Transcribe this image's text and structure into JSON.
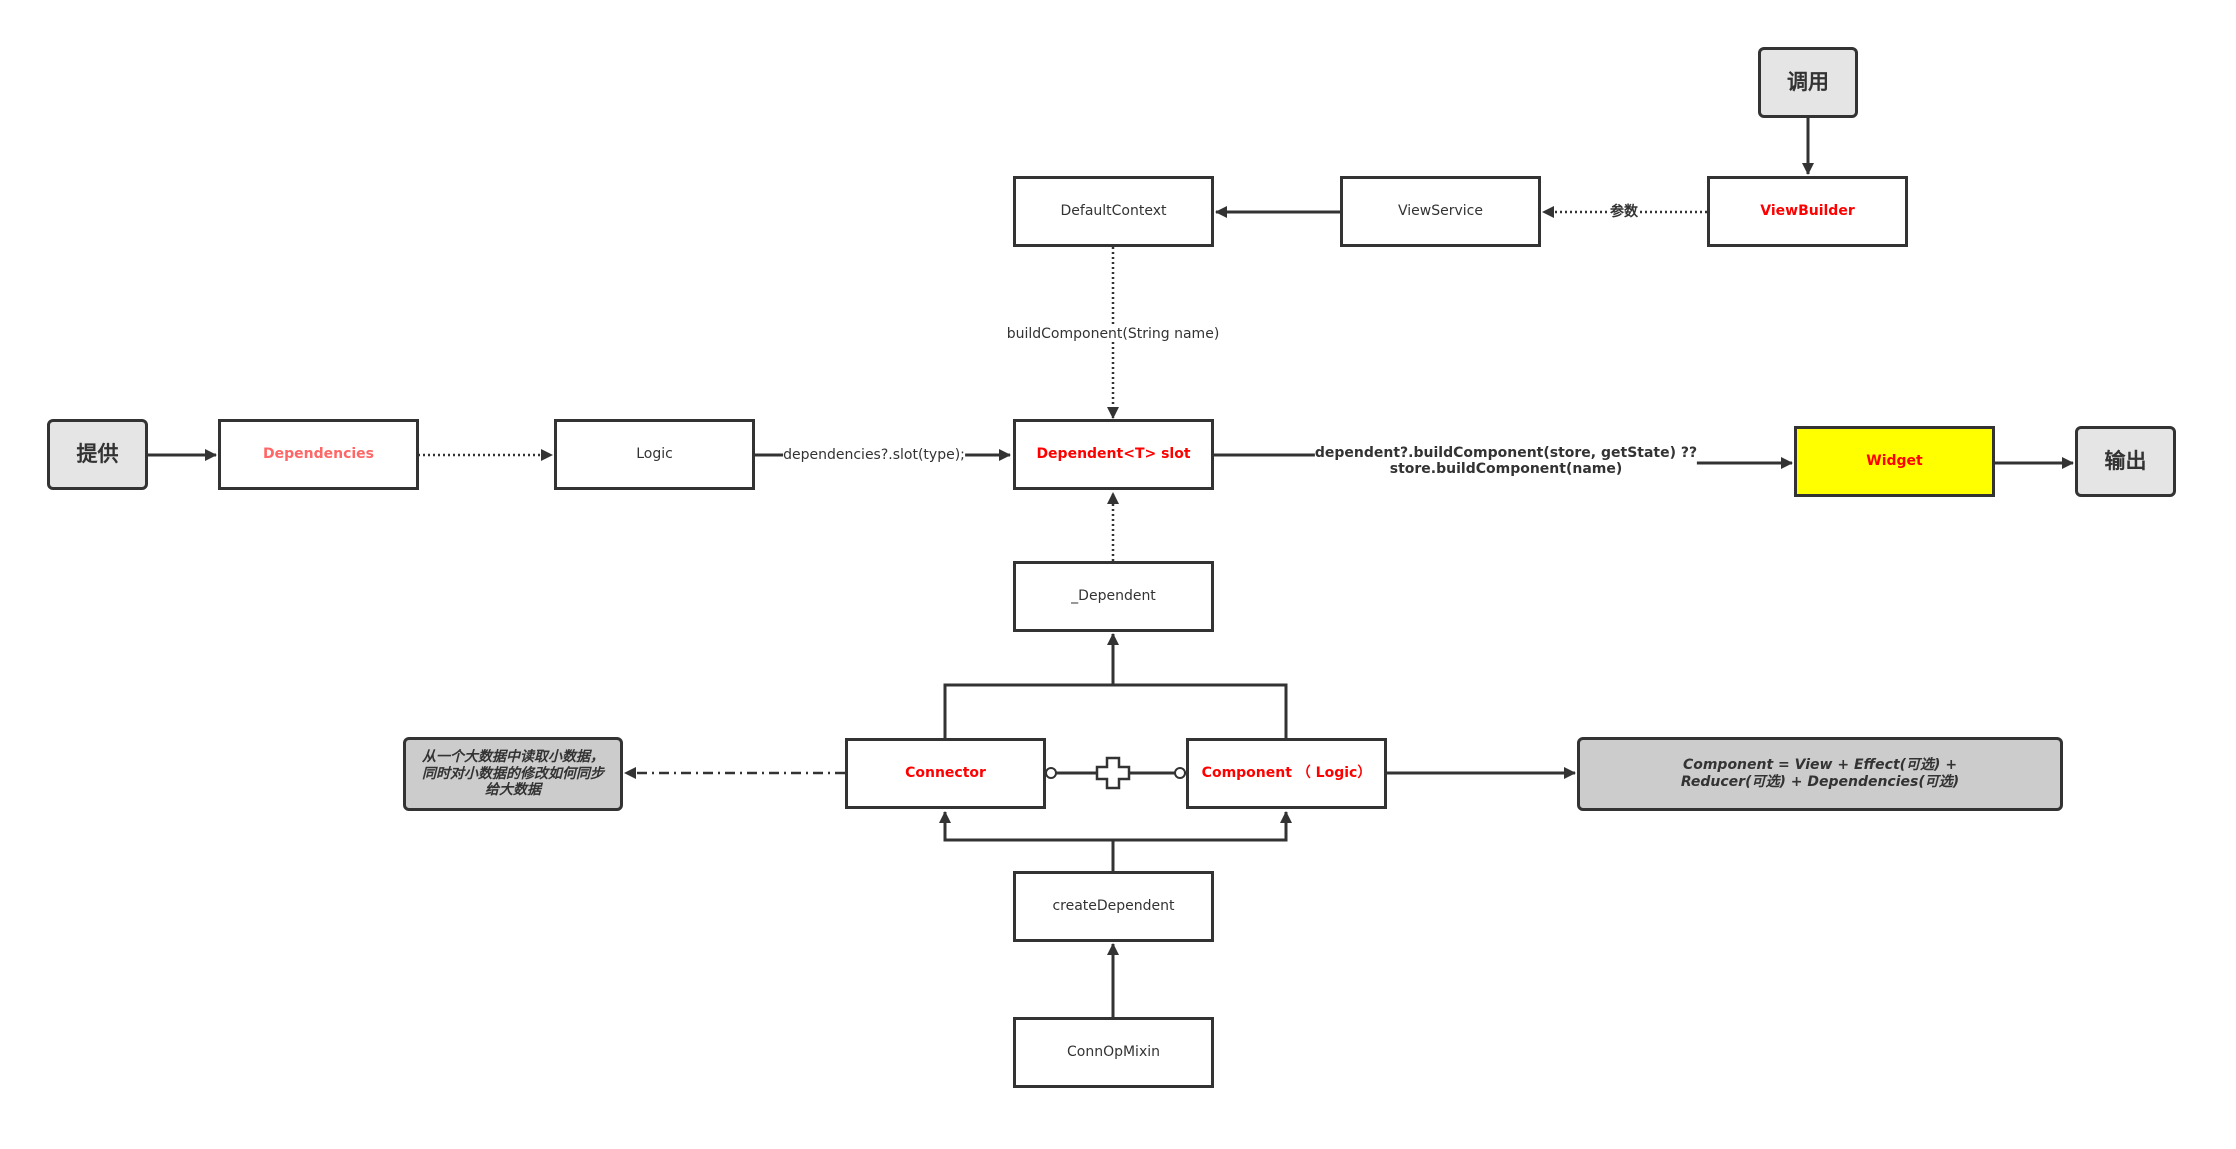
{
  "diagram": {
    "nodes": {
      "invoke": {
        "label": "调用",
        "kind": "terminal"
      },
      "provide": {
        "label": "提供",
        "kind": "terminal"
      },
      "output": {
        "label": "输出",
        "kind": "terminal"
      },
      "default_context": {
        "label": "DefaultContext"
      },
      "view_service": {
        "label": "ViewService"
      },
      "view_builder": {
        "label": "ViewBuilder",
        "emphasis": "red"
      },
      "dependencies": {
        "label": "Dependencies",
        "emphasis": "salmon"
      },
      "logic": {
        "label": "Logic"
      },
      "dependent_slot": {
        "label": "Dependent<T> slot",
        "emphasis": "red"
      },
      "widget": {
        "label": "Widget",
        "emphasis": "red",
        "fill": "#ffff00"
      },
      "underscore_dependent": {
        "label": "_Dependent"
      },
      "connector": {
        "label": "Connector",
        "emphasis": "red"
      },
      "component_logic": {
        "label": "Component （ Logic）",
        "emphasis": "red"
      },
      "create_dependent": {
        "label": "createDependent"
      },
      "conn_op_mixin": {
        "label": "ConnOpMixin"
      },
      "note_connector": {
        "label": "从一个大数据中读取小数据，同时对小数据的修改如何同步给大数据",
        "kind": "note"
      },
      "note_component": {
        "label": "Component = View + Effect(可选) + Reducer(可选) + Dependencies(可选)",
        "kind": "note"
      }
    },
    "edges": [
      {
        "from": "invoke",
        "to": "view_builder",
        "style": "solid"
      },
      {
        "from": "view_builder",
        "to": "view_service",
        "style": "dotted",
        "label": "参数"
      },
      {
        "from": "view_service",
        "to": "default_context",
        "style": "solid"
      },
      {
        "from": "default_context",
        "to": "dependent_slot",
        "style": "dotted",
        "label": "buildComponent(String name)"
      },
      {
        "from": "provide",
        "to": "dependencies",
        "style": "solid"
      },
      {
        "from": "dependencies",
        "to": "logic",
        "style": "dotted"
      },
      {
        "from": "logic",
        "to": "dependent_slot",
        "style": "solid",
        "label": "dependencies?.slot(type);"
      },
      {
        "from": "dependent_slot",
        "to": "widget",
        "style": "solid",
        "label": "dependent?.buildComponent(store, getState) ??\nstore.buildComponent(name)"
      },
      {
        "from": "widget",
        "to": "output",
        "style": "solid"
      },
      {
        "from": "underscore_dependent",
        "to": "dependent_slot",
        "style": "dotted"
      },
      {
        "from": "connector",
        "to": "underscore_dependent",
        "style": "solid"
      },
      {
        "from": "component_logic",
        "to": "underscore_dependent",
        "style": "solid"
      },
      {
        "from": "connector",
        "to": "component_logic",
        "style": "plus-join"
      },
      {
        "from": "connector",
        "to": "note_connector",
        "style": "dash-dot"
      },
      {
        "from": "component_logic",
        "to": "note_component",
        "style": "solid"
      },
      {
        "from": "create_dependent",
        "to": "connector",
        "style": "solid"
      },
      {
        "from": "create_dependent",
        "to": "component_logic",
        "style": "solid"
      },
      {
        "from": "conn_op_mixin",
        "to": "create_dependent",
        "style": "solid"
      }
    ]
  }
}
